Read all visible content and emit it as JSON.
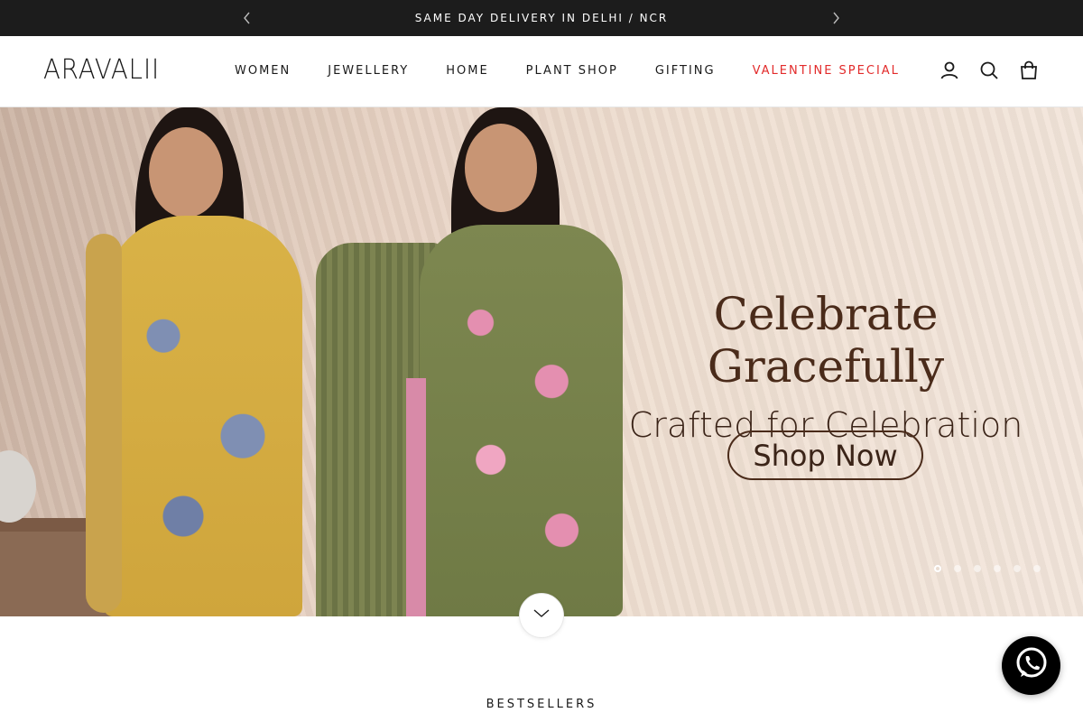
{
  "announcement": {
    "text": "SAME DAY DELIVERY IN DELHI / NCR"
  },
  "brand": {
    "logo": "ARAVALII"
  },
  "nav": {
    "items": [
      {
        "label": "WOMEN"
      },
      {
        "label": "JEWELLERY"
      },
      {
        "label": "HOME"
      },
      {
        "label": "PLANT SHOP"
      },
      {
        "label": "GIFTING"
      },
      {
        "label": "VALENTINE SPECIAL"
      }
    ],
    "special_color": "#e22b2b"
  },
  "header_icons": [
    "account-icon",
    "search-icon",
    "cart-icon"
  ],
  "hero": {
    "title": "Celebrate Gracefully",
    "subtitle": "Crafted for Celebration",
    "cta": "Shop Now",
    "slide_count": 6,
    "active_slide": 1
  },
  "section": {
    "heading": "BESTSELLERS"
  },
  "colors": {
    "announce_bg": "#1c1c1c",
    "hero_text": "#4a2b1a"
  }
}
